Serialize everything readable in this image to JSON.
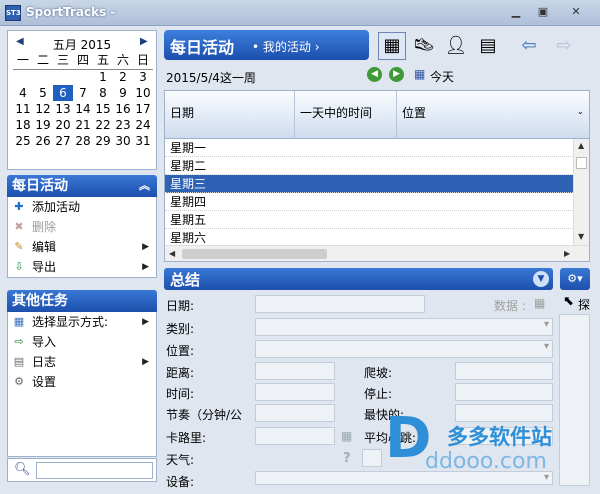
{
  "window": {
    "title": "SportTracks -",
    "app_icon": "ST3"
  },
  "calendar": {
    "month_label": "五月  2015",
    "weekdays": [
      "一",
      "二",
      "三",
      "四",
      "五",
      "六",
      "日"
    ],
    "weeks": [
      [
        "",
        "",
        "",
        "",
        "1",
        "2",
        "3"
      ],
      [
        "4",
        "5",
        "6",
        "7",
        "8",
        "9",
        "10"
      ],
      [
        "11",
        "12",
        "13",
        "14",
        "15",
        "16",
        "17"
      ],
      [
        "18",
        "19",
        "20",
        "21",
        "22",
        "23",
        "24"
      ],
      [
        "25",
        "26",
        "27",
        "28",
        "29",
        "30",
        "31"
      ]
    ],
    "selected_day": "6"
  },
  "daily_tasks": {
    "title": "每日活动",
    "items": [
      {
        "label": "添加活动",
        "icon": "add-icon",
        "enabled": true,
        "submenu": false
      },
      {
        "label": "删除",
        "icon": "delete-icon",
        "enabled": false,
        "submenu": false
      },
      {
        "label": "编辑",
        "icon": "edit-icon",
        "enabled": true,
        "submenu": true
      },
      {
        "label": "导出",
        "icon": "export-icon",
        "enabled": true,
        "submenu": true
      }
    ]
  },
  "other_tasks": {
    "title": "其他任务",
    "items": [
      {
        "label": "选择显示方式:",
        "icon": "view-icon",
        "submenu": true
      },
      {
        "label": "导入",
        "icon": "import-icon",
        "submenu": false
      },
      {
        "label": "日志",
        "icon": "log-icon",
        "submenu": true
      },
      {
        "label": "设置",
        "icon": "settings-icon",
        "submenu": false
      }
    ]
  },
  "search": {
    "value": ""
  },
  "main": {
    "title": "每日活动",
    "subtitle": "• 我的活动 ›",
    "date_line": "2015/5/4这一周",
    "today_label": "今天"
  },
  "grid": {
    "columns": [
      "日期",
      "一天中的时间",
      "位置"
    ],
    "rows": [
      "星期一",
      "星期二",
      "星期三",
      "星期四",
      "星期五",
      "星期六"
    ],
    "selected_row": 2
  },
  "summary": {
    "title": "总结",
    "data_label": "数据 :",
    "probe_label": "探",
    "left_fields": [
      "日期:",
      "类别:",
      "位置:",
      "距离:",
      "时间:",
      "节奏（分钟/公",
      "卡路里:",
      "天气:",
      "设备:"
    ],
    "right_fields": [
      "爬坡:",
      "停止:",
      "最快的:",
      "平均心跳:"
    ]
  },
  "watermark": {
    "logo": "D",
    "name": "多多软件站",
    "url": "ddooo.com"
  }
}
